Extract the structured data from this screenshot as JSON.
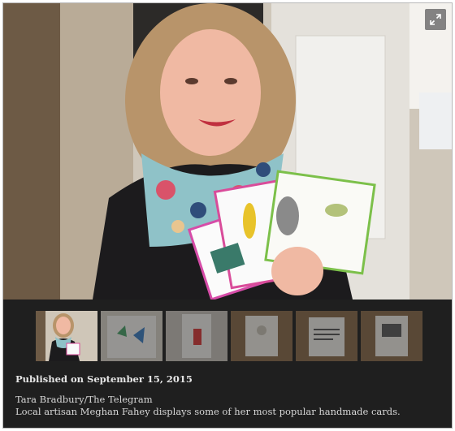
{
  "gallery": {
    "expand_icon": "expand-arrows-icon",
    "thumbnails": [
      {
        "subject": "woman holding cards",
        "active": true
      },
      {
        "subject": "butterfly card",
        "active": false
      },
      {
        "subject": "red bottle card",
        "active": false
      },
      {
        "subject": "framed card",
        "active": false
      },
      {
        "subject": "text card",
        "active": false
      },
      {
        "subject": "photo card",
        "active": false
      }
    ]
  },
  "caption": {
    "published": "Published on September 15, 2015",
    "credit": "Tara Bradbury/The Telegram",
    "description": "Local artisan Meghan Fahey displays some of her most popular handmade cards."
  },
  "colors": {
    "panel_background": "#1f1f1f",
    "caption_text": "#d8d8d8"
  }
}
